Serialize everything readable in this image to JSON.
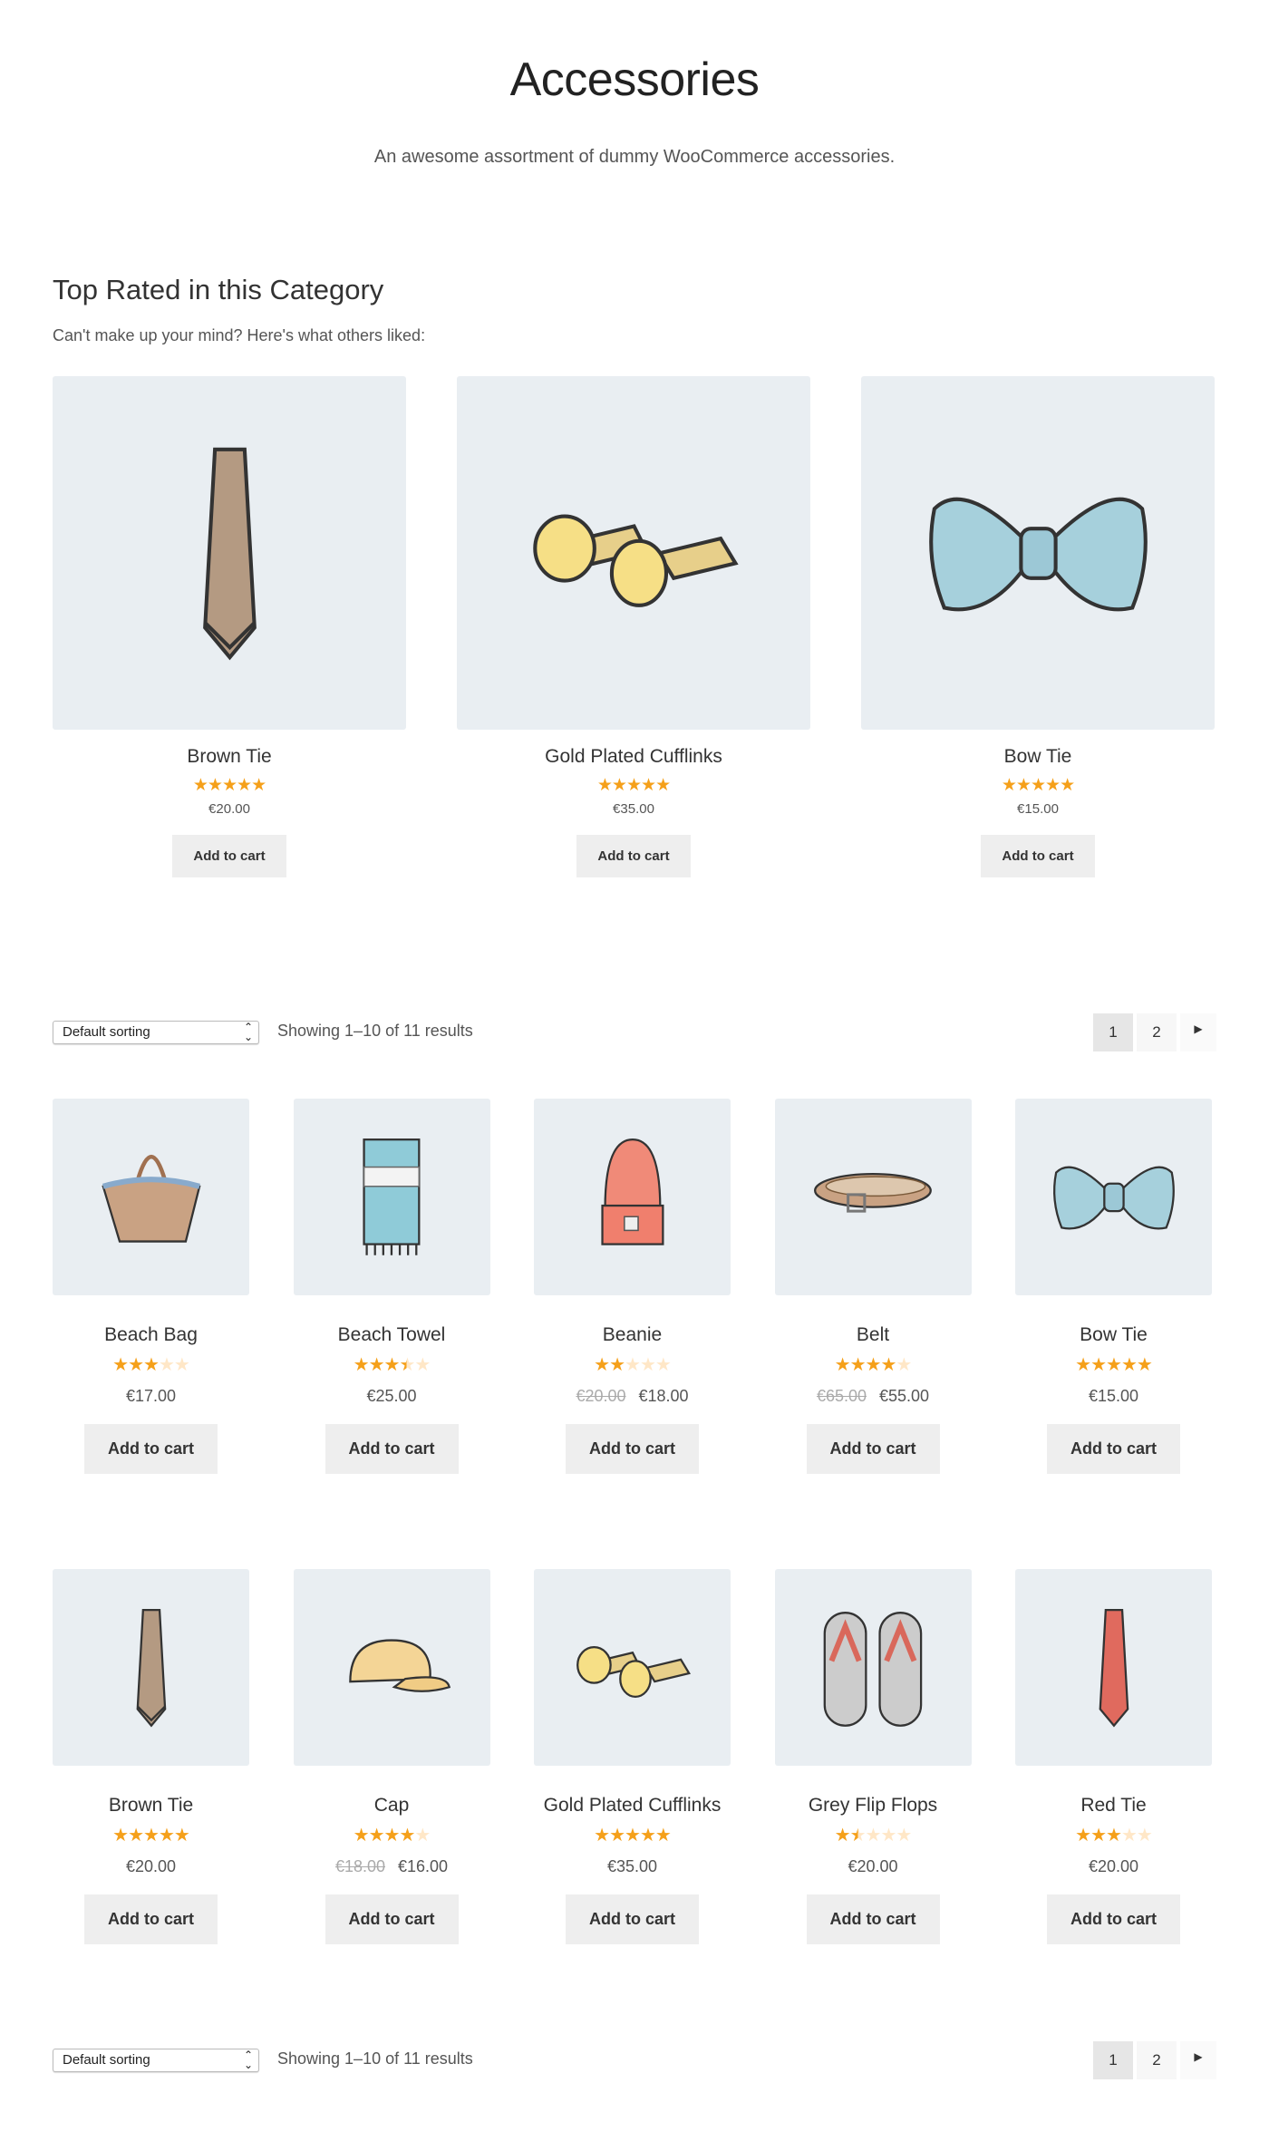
{
  "page": {
    "title": "Accessories",
    "description": "An awesome assortment of dummy WooCommerce accessories."
  },
  "top_rated": {
    "heading": "Top Rated in this Category",
    "subheading": "Can't make up your mind? Here's what others liked:",
    "products": [
      {
        "name": "Brown Tie",
        "rating": 5,
        "price": "€20.00",
        "image": "brown-tie",
        "button": "Add to cart"
      },
      {
        "name": "Gold Plated Cufflinks",
        "rating": 5,
        "price": "€35.00",
        "image": "cufflinks",
        "button": "Add to cart"
      },
      {
        "name": "Bow Tie",
        "rating": 5,
        "price": "€15.00",
        "image": "bow-tie",
        "button": "Add to cart"
      }
    ]
  },
  "toolbar": {
    "sorting": "Default sorting",
    "result_count": "Showing 1–10 of 11 results",
    "pages": [
      "1",
      "2"
    ],
    "current_page": "1",
    "next_icon": "caret-right-icon"
  },
  "products": [
    {
      "name": "Beach Bag",
      "rating": 3,
      "price": "€17.00",
      "image": "beach-bag",
      "button": "Add to cart"
    },
    {
      "name": "Beach Towel",
      "rating": 3.5,
      "price": "€25.00",
      "image": "beach-towel",
      "button": "Add to cart"
    },
    {
      "name": "Beanie",
      "rating": 2,
      "regular_price": "€20.00",
      "price": "€18.00",
      "image": "beanie",
      "button": "Add to cart"
    },
    {
      "name": "Belt",
      "rating": 4,
      "regular_price": "€65.00",
      "price": "€55.00",
      "image": "belt",
      "button": "Add to cart"
    },
    {
      "name": "Bow Tie",
      "rating": 5,
      "price": "€15.00",
      "image": "bow-tie",
      "button": "Add to cart"
    },
    {
      "name": "Brown Tie",
      "rating": 5,
      "price": "€20.00",
      "image": "brown-tie",
      "button": "Add to cart"
    },
    {
      "name": "Cap",
      "rating": 4,
      "regular_price": "€18.00",
      "price": "€16.00",
      "image": "cap",
      "button": "Add to cart"
    },
    {
      "name": "Gold Plated Cufflinks",
      "rating": 5,
      "price": "€35.00",
      "image": "cufflinks",
      "button": "Add to cart"
    },
    {
      "name": "Grey Flip Flops",
      "rating": 1.5,
      "price": "€20.00",
      "image": "flip-flops",
      "button": "Add to cart"
    },
    {
      "name": "Red Tie",
      "rating": 3,
      "price": "€20.00",
      "image": "red-tie",
      "button": "Add to cart"
    }
  ],
  "colors": {
    "star": "#f5a01a",
    "star_empty": "#ffe7c7",
    "image_bg": "#e9eef2",
    "button_bg": "#eeeeee"
  }
}
